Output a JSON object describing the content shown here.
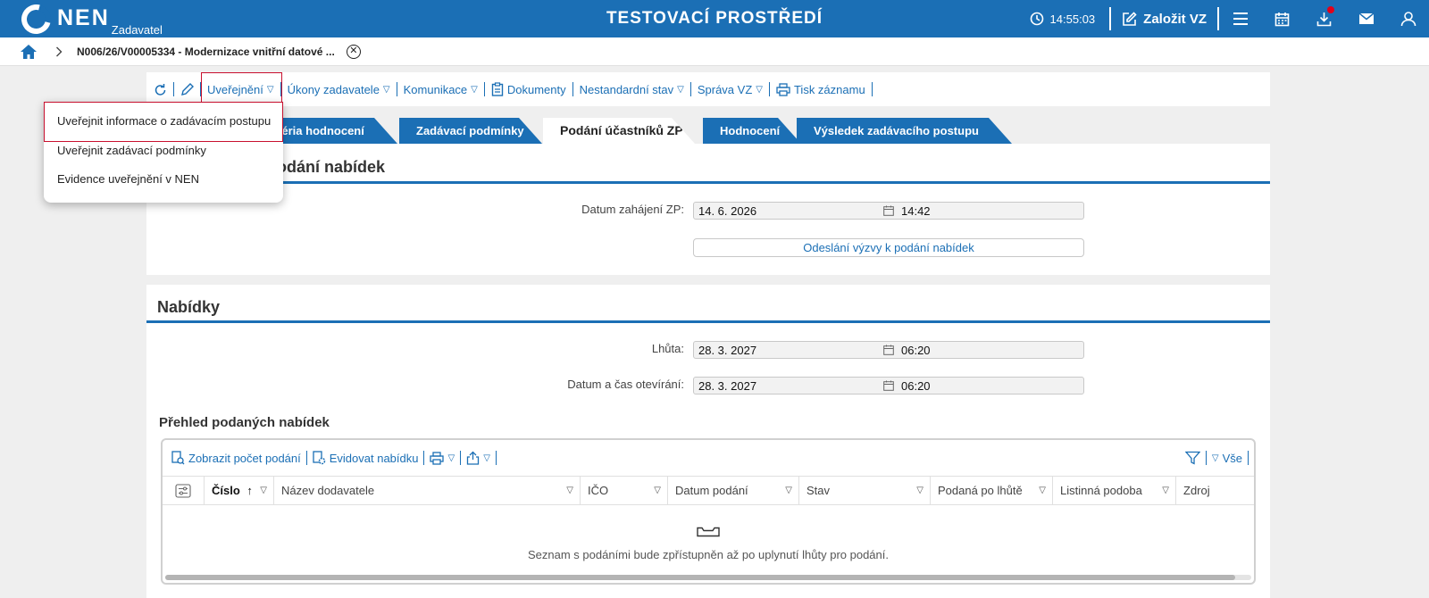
{
  "app": {
    "logo_text": "NEN",
    "logo_sub": "Zadavatel",
    "env_title": "TESTOVACÍ PROSTŘEDÍ",
    "clock": "14:55:03",
    "create_label": "Založit VZ"
  },
  "breadcrumb": {
    "text": "N006/26/V00005334 - Modernizace vnitřní datové ..."
  },
  "toolbar": {
    "publish": "Uveřejnění",
    "acts": "Úkony zadavatele",
    "communication": "Komunikace",
    "documents": "Dokumenty",
    "nonstandard": "Nestandardní stav",
    "admin": "Správa VZ",
    "print": "Tisk záznamu"
  },
  "dropdown": {
    "items": [
      "Uveřejnit informace o zadávacím postupu",
      "Uveřejnit zadávací podmínky",
      "Evidence uveřejnění v NEN"
    ]
  },
  "tabs": {
    "criteria": "Kritéria hodnocení",
    "conditions": "Zadávací podmínky",
    "submissions": "Podání účastníků ZP",
    "evaluation": "Hodnocení",
    "result": "Výsledek zadávacího postupu"
  },
  "invitation": {
    "title_fragment": "podání nabídek",
    "start_label": "Datum zahájení ZP:",
    "start_date": "14. 6. 2026",
    "start_time": "14:42",
    "send_button": "Odeslání výzvy k podání nabídek"
  },
  "offers": {
    "title": "Nabídky",
    "deadline_label": "Lhůta:",
    "deadline_date": "28. 3. 2027",
    "deadline_time": "06:20",
    "opening_label": "Datum a čas otevírání:",
    "opening_date": "28. 3. 2027",
    "opening_time": "06:20",
    "overview_title": "Přehled podaných nabídek",
    "tools": {
      "show_count": "Zobrazit počet podání",
      "register": "Evidovat nabídku",
      "all": "Vše"
    },
    "columns": [
      "Číslo",
      "Název dodavatele",
      "IČO",
      "Datum podání",
      "Stav",
      "Podaná po lhůtě",
      "Listinná podoba",
      "Zdroj"
    ],
    "empty_text": "Seznam s podáními bude zpřístupněn až po uplynutí lhůty pro podání."
  }
}
